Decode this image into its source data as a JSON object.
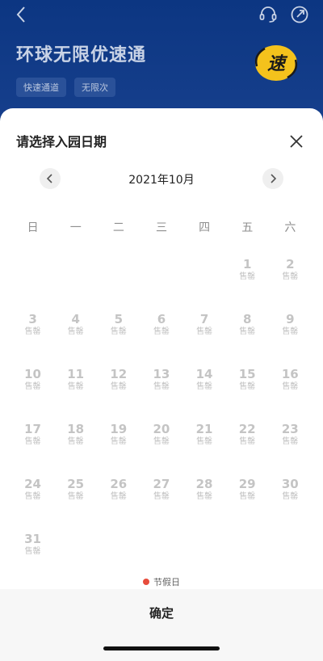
{
  "header": {
    "title": "环球无限优速通",
    "tags": [
      "快速通道",
      "无限次"
    ],
    "logo_text": "速"
  },
  "sheet": {
    "title": "请选择入园日期",
    "month_label": "2021年10月",
    "weekdays": [
      "日",
      "一",
      "二",
      "三",
      "四",
      "五",
      "六"
    ],
    "weeks": [
      [
        null,
        null,
        null,
        null,
        null,
        {
          "day": "1",
          "status": "售罄"
        },
        {
          "day": "2",
          "status": "售罄"
        }
      ],
      [
        {
          "day": "3",
          "status": "售罄"
        },
        {
          "day": "4",
          "status": "售罄"
        },
        {
          "day": "5",
          "status": "售罄"
        },
        {
          "day": "6",
          "status": "售罄"
        },
        {
          "day": "7",
          "status": "售罄"
        },
        {
          "day": "8",
          "status": "售罄"
        },
        {
          "day": "9",
          "status": "售罄"
        }
      ],
      [
        {
          "day": "10",
          "status": "售罄"
        },
        {
          "day": "11",
          "status": "售罄"
        },
        {
          "day": "12",
          "status": "售罄"
        },
        {
          "day": "13",
          "status": "售罄"
        },
        {
          "day": "14",
          "status": "售罄"
        },
        {
          "day": "15",
          "status": "售罄"
        },
        {
          "day": "16",
          "status": "售罄"
        }
      ],
      [
        {
          "day": "17",
          "status": "售罄"
        },
        {
          "day": "18",
          "status": "售罄"
        },
        {
          "day": "19",
          "status": "售罄"
        },
        {
          "day": "20",
          "status": "售罄"
        },
        {
          "day": "21",
          "status": "售罄"
        },
        {
          "day": "22",
          "status": "售罄"
        },
        {
          "day": "23",
          "status": "售罄"
        }
      ],
      [
        {
          "day": "24",
          "status": "售罄"
        },
        {
          "day": "25",
          "status": "售罄"
        },
        {
          "day": "26",
          "status": "售罄"
        },
        {
          "day": "27",
          "status": "售罄"
        },
        {
          "day": "28",
          "status": "售罄"
        },
        {
          "day": "29",
          "status": "售罄"
        },
        {
          "day": "30",
          "status": "售罄"
        }
      ],
      [
        {
          "day": "31",
          "status": "售罄"
        },
        null,
        null,
        null,
        null,
        null,
        null
      ]
    ],
    "legend_label": "节假日",
    "confirm_label": "确定"
  },
  "icons": {
    "back": "chevron-left-icon",
    "service": "headset-icon",
    "share": "share-icon",
    "close": "close-icon",
    "prev": "chevron-left-icon",
    "next": "chevron-right-icon"
  },
  "colors": {
    "header_bg": "#0c3682",
    "holiday_dot": "#e74c3c",
    "sold_out_text": "#c4c4c4",
    "logo_yellow": "#f4c21c"
  }
}
